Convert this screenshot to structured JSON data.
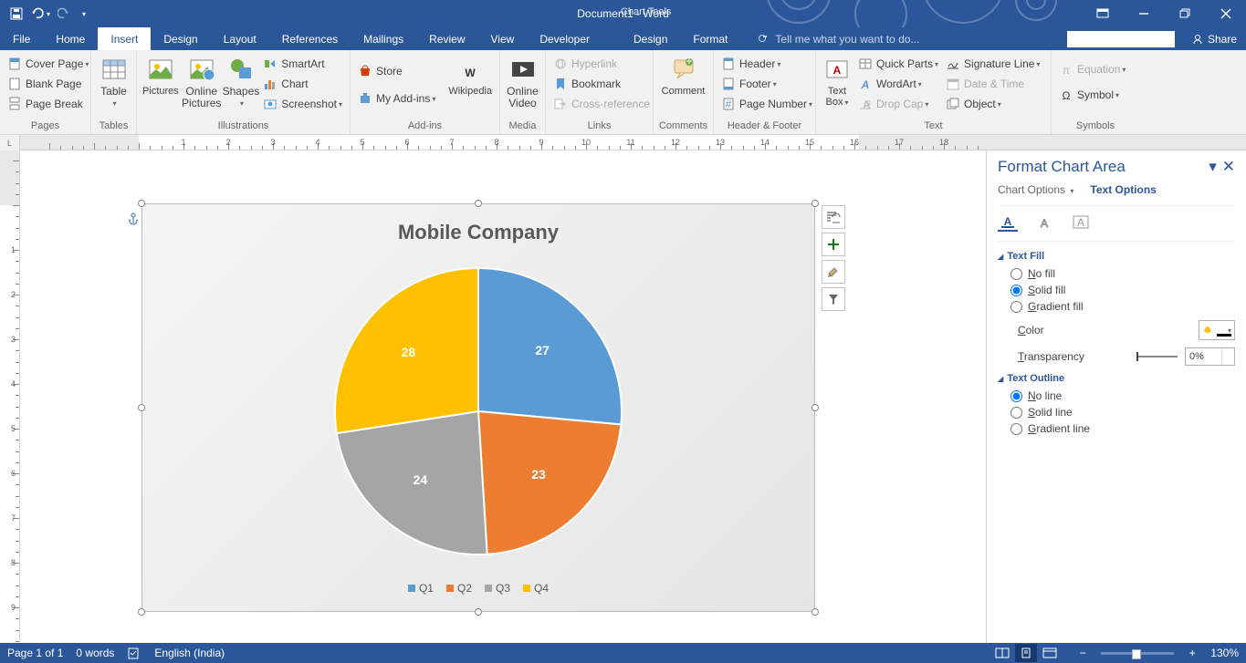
{
  "title": "Document1 - Word",
  "chart_tools_label": "Chart Tools",
  "qat": {
    "save": "Save",
    "undo": "Undo",
    "redo": "Redo"
  },
  "tabs": {
    "file": "File",
    "home": "Home",
    "insert": "Insert",
    "design": "Design",
    "layout": "Layout",
    "references": "References",
    "mailings": "Mailings",
    "review": "Review",
    "view": "View",
    "developer": "Developer",
    "ct_design": "Design",
    "ct_format": "Format"
  },
  "tell_me": "Tell me what you want to do...",
  "share": "Share",
  "ribbon": {
    "pages": {
      "cover": "Cover Page",
      "blank": "Blank Page",
      "break": "Page Break",
      "group": "Pages"
    },
    "tables": {
      "table": "Table",
      "group": "Tables"
    },
    "illus": {
      "pictures": "Pictures",
      "online_pics": "Online Pictures",
      "shapes": "Shapes",
      "smartart": "SmartArt",
      "chart": "Chart",
      "screenshot": "Screenshot",
      "group": "Illustrations"
    },
    "addins": {
      "store": "Store",
      "myaddins": "My Add-ins",
      "wikipedia": "Wikipedia",
      "group": "Add-ins"
    },
    "media": {
      "online_video": "Online Video",
      "group": "Media"
    },
    "links": {
      "hyperlink": "Hyperlink",
      "bookmark": "Bookmark",
      "crossref": "Cross-reference",
      "group": "Links"
    },
    "comments": {
      "comment": "Comment",
      "group": "Comments"
    },
    "hf": {
      "header": "Header",
      "footer": "Footer",
      "pagenum": "Page Number",
      "group": "Header & Footer"
    },
    "text": {
      "textbox": "Text Box",
      "quick": "Quick Parts",
      "wordart": "WordArt",
      "dropcap": "Drop Cap",
      "sigline": "Signature Line",
      "datetime": "Date & Time",
      "object": "Object",
      "group": "Text"
    },
    "symbols": {
      "equation": "Equation",
      "symbol": "Symbol",
      "group": "Symbols"
    }
  },
  "chart_data": {
    "type": "pie",
    "title": "Mobile Company",
    "categories": [
      "Q1",
      "Q2",
      "Q3",
      "Q4"
    ],
    "values": [
      27,
      23,
      24,
      28
    ],
    "colors": [
      "#5b9bd5",
      "#ed7d31",
      "#a5a5a5",
      "#ffc000"
    ]
  },
  "chart_side": {
    "layout": "Layout Options",
    "plus": "Chart Elements",
    "brush": "Chart Styles",
    "funnel": "Chart Filters"
  },
  "pane": {
    "title": "Format Chart Area",
    "chart_options": "Chart Options",
    "text_options": "Text Options",
    "text_fill": "Text Fill",
    "no_fill": "No fill",
    "solid_fill": "Solid fill",
    "gradient_fill": "Gradient fill",
    "color": "Color",
    "transparency": "Transparency",
    "transparency_val": "0%",
    "text_outline": "Text Outline",
    "no_line": "No line",
    "solid_line": "Solid line",
    "gradient_line": "Gradient line"
  },
  "status": {
    "page": "Page 1 of 1",
    "words": "0 words",
    "lang": "English (India)",
    "zoom": "130%"
  }
}
